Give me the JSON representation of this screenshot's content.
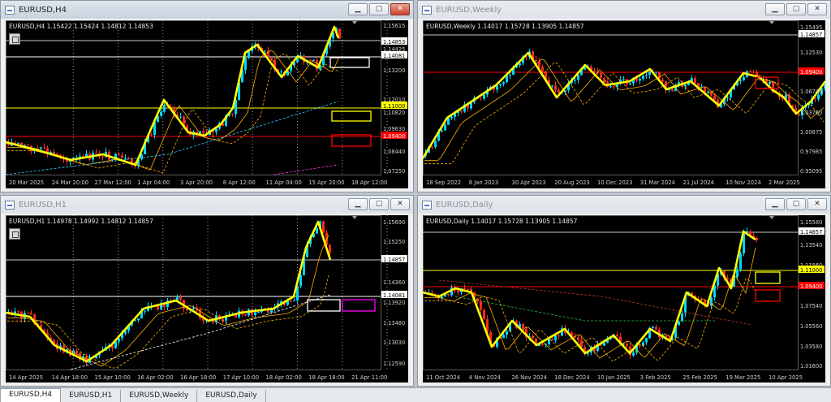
{
  "windows": [
    {
      "id": "h4",
      "title": "EURUSD,H4",
      "active": true,
      "ohlc": "EURUSD,H4  1.15422 1.15424 1.14812 1.14853",
      "price_labels": [
        "1.15615",
        "1.14853",
        "1.14425",
        "1.14081",
        "1.13200",
        "1.12010",
        "1.11000",
        "1.10820",
        "1.09630",
        "1.09400",
        "1.08440",
        "1.07250"
      ],
      "time_labels": [
        "20 Mar 2025",
        "24 Mar 20:00",
        "27 Mar 12:00",
        "1 Apr 04:00",
        "3 Apr 20:00",
        "8 Apr 12:00",
        "11 Apr 04:00",
        "15 Apr 20:00",
        "18 Apr 12:00"
      ],
      "boxes": [
        {
          "color": "#ffffff"
        },
        {
          "color": "#ffff00"
        },
        {
          "color": "#ff0000"
        }
      ]
    },
    {
      "id": "weekly",
      "title": "EURUSD,Weekly",
      "active": false,
      "ohlc": "EURUSD,Weekly  1.14017 1.15728 1.13905 1.14857",
      "price_labels": [
        "1.15495",
        "1.14857",
        "1.12530",
        "1.09400",
        "1.06740",
        "1.03760",
        "1.00875",
        "0.97985",
        "0.95095"
      ],
      "time_labels": [
        "18 Sep 2022",
        "8 Jan 2023",
        "30 Apr 2023",
        "20 Aug 2023",
        "10 Dec 2023",
        "31 Mar 2024",
        "21 Jul 2024",
        "10 Nov 2024",
        "2 Mar 2025"
      ],
      "boxes": [
        {
          "color": "#ff0000"
        }
      ]
    },
    {
      "id": "h1",
      "title": "EURUSD,H1",
      "active": false,
      "ohlc": "EURUSD,H1  1.14978 1.14992 1.14812 1.14857",
      "price_labels": [
        "1.15690",
        "1.15250",
        "1.14857",
        "1.14360",
        "1.14081",
        "1.13920",
        "1.13480",
        "1.13030",
        "1.12590"
      ],
      "time_labels": [
        "14 Apr 2025",
        "14 Apr 18:00",
        "15 Apr 10:00",
        "16 Apr 02:00",
        "16 Apr 18:00",
        "17 Apr 10:00",
        "18 Apr 02:00",
        "18 Apr 18:00",
        "21 Apr 11:00"
      ],
      "boxes": [
        {
          "color": "#ffffff"
        },
        {
          "color": "#ff00ff"
        }
      ]
    },
    {
      "id": "daily",
      "title": "EURUSD,Daily",
      "active": false,
      "ohlc": "EURUSD,Daily  1.14017 1.15728 1.13905 1.14857",
      "price_labels": [
        "1.15580",
        "1.14857",
        "1.13540",
        "1.11560",
        "1.11000",
        "1.09400",
        "1.07540",
        "1.05560",
        "1.03580",
        "1.01600"
      ],
      "time_labels": [
        "11 Oct 2024",
        "4 Nov 2024",
        "26 Nov 2024",
        "18 Dec 2024",
        "10 Jan 2025",
        "3 Feb 2025",
        "25 Feb 2025",
        "19 Mar 2025",
        "10 Apr 2025"
      ],
      "boxes": [
        {
          "color": "#ffff00"
        },
        {
          "color": "#ff0000"
        }
      ]
    }
  ],
  "tabs": [
    "EURUSD,H4",
    "EURUSD,H1",
    "EURUSD,Weekly",
    "EURUSD,Daily"
  ],
  "colors": {
    "bull": "#00d5ff",
    "bear": "#ff2a1a",
    "zigzag": "#ffff00",
    "ma_fast": "#ffb000",
    "ma_slow": "#00c0ff",
    "background": "#000000"
  }
}
